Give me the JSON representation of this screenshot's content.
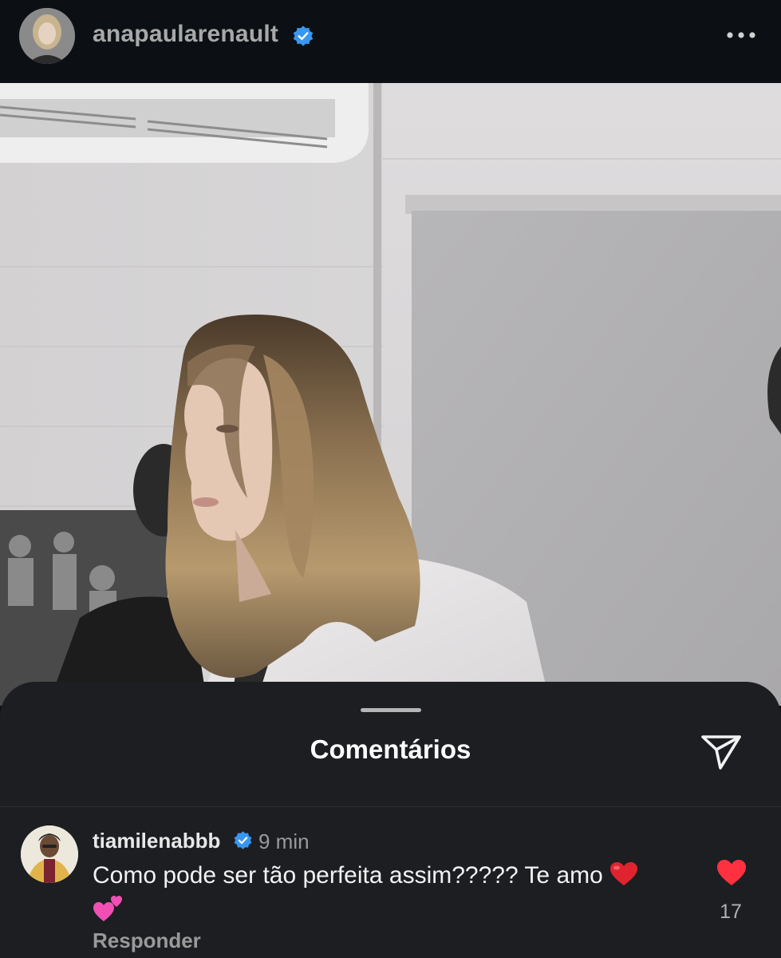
{
  "post": {
    "username": "anapaularenault",
    "verified": true,
    "more_icon": "more-horizontal-icon"
  },
  "comments_sheet": {
    "title": "Comentários",
    "share_icon": "send-icon"
  },
  "comments": [
    {
      "username": "tiamilenabbb",
      "verified": true,
      "time": "9 min",
      "text": "Como pode ser tão perfeita assim????? Te amo",
      "emojis": [
        "red-heart",
        "two-hearts"
      ],
      "reply_label": "Responder",
      "liked": true,
      "like_count": "17"
    }
  ],
  "colors": {
    "background": "#0c1014",
    "sheet": "#1c1e22",
    "verified_blue": "#3897f0",
    "like_red": "#ff3040"
  }
}
